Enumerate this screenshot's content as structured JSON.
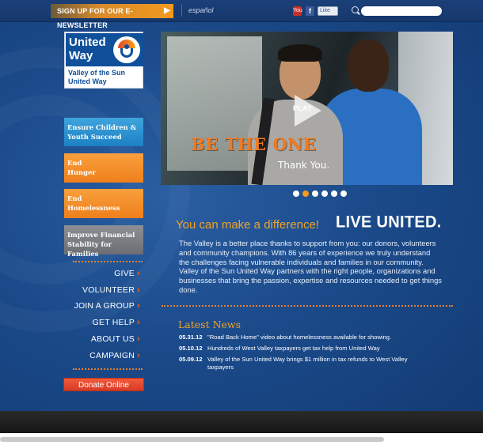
{
  "topbar": {
    "newsletter_label": "SIGN UP FOR OUR E-NEWSLETTER",
    "language_label": "español",
    "social": {
      "youtube_label": "You",
      "facebook_label": "f",
      "like_label": "Like"
    },
    "search": {
      "placeholder": ""
    }
  },
  "logo": {
    "title": "United Way",
    "subtitle": "Valley of the Sun United Way"
  },
  "sidebar": {
    "goals": [
      {
        "label": "Ensure Children & Youth Succeed"
      },
      {
        "label": "End Hunger"
      },
      {
        "label": "End Homelessness"
      },
      {
        "label": "Improve Financial Stability for Families"
      }
    ],
    "menu": [
      {
        "label": "GIVE"
      },
      {
        "label": "VOLUNTEER"
      },
      {
        "label": "JOIN A GROUP"
      },
      {
        "label": "GET HELP"
      },
      {
        "label": "ABOUT US"
      },
      {
        "label": "CAMPAIGN"
      }
    ],
    "donate_label": "Donate Online"
  },
  "hero": {
    "play_label": "PLAY",
    "title": "BE THE ONE",
    "subtitle": "Thank You.",
    "slide_count": 6,
    "active_slide": 2
  },
  "main": {
    "tagline": "You can make a difference!",
    "live_united": "LIVE UNITED.",
    "intro": "The Valley is a better place thanks to support from you: our donors, volunteers and community champions. With 86 years of experience we truly understand the challenges facing vulnerable individuals and families in our community. Valley of the Sun United Way partners with the right people, organizations and businesses that bring the passion, expertise and resources needed to get things done.",
    "news_heading": "Latest News",
    "news": [
      {
        "date": "05.31.12",
        "text": "\"Road Back Home\" video about homelessness available for showing."
      },
      {
        "date": "05.10.12",
        "text": "Hundreds of West Valley taxpayers get tax help from United Way"
      },
      {
        "date": "05.09.12",
        "text": "Valley of the Sun United Way brings $1 million in tax refunds to West Valley taxpayers"
      }
    ]
  },
  "colors": {
    "brand_blue": "#10509a",
    "accent_orange": "#f39a1e",
    "donate_red": "#e0442b"
  }
}
